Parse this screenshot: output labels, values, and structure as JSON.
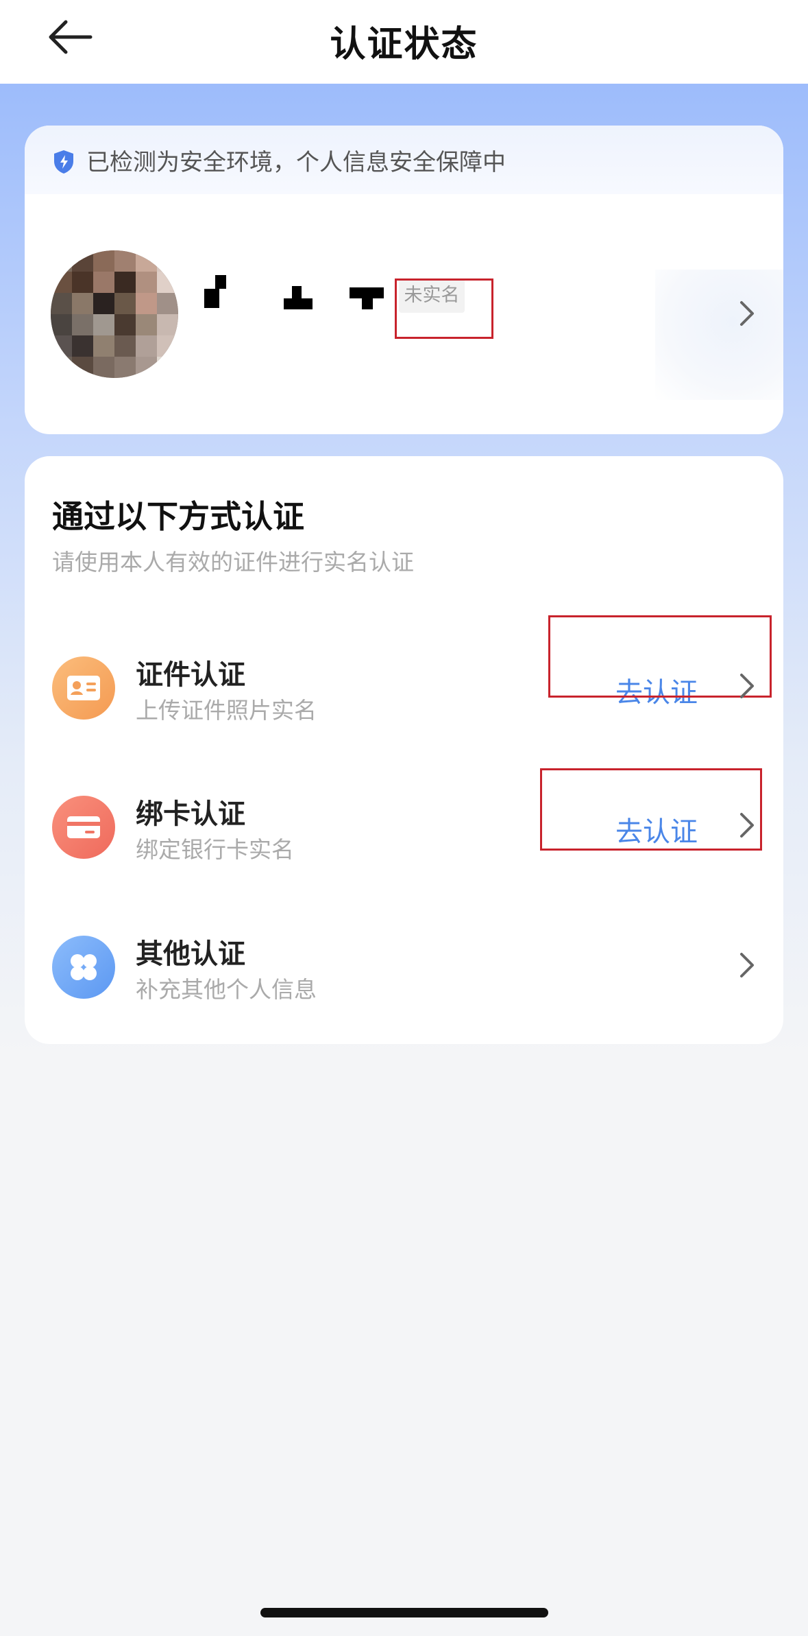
{
  "header": {
    "title": "认证状态",
    "back_icon": "arrow-left-icon"
  },
  "safety_banner": {
    "text": "已检测为安全环境，个人信息安全保障中",
    "icon": "shield-icon"
  },
  "profile": {
    "status_badge": "未实名"
  },
  "verification": {
    "title": "通过以下方式认证",
    "subtitle": "请使用本人有效的证件进行实名认证",
    "methods": [
      {
        "name": "证件认证",
        "desc": "上传证件照片实名",
        "action": "去认证",
        "icon": "id-card-icon",
        "color": "#f7a35c"
      },
      {
        "name": "绑卡认证",
        "desc": "绑定银行卡实名",
        "action": "去认证",
        "icon": "bank-card-icon",
        "color": "#f27d6e"
      },
      {
        "name": "其他认证",
        "desc": "补充其他个人信息",
        "action": "",
        "icon": "grid-icon",
        "color": "#6ea6f5"
      }
    ]
  },
  "colors": {
    "accent": "#4a86e8",
    "highlight_box": "#c8232c"
  }
}
